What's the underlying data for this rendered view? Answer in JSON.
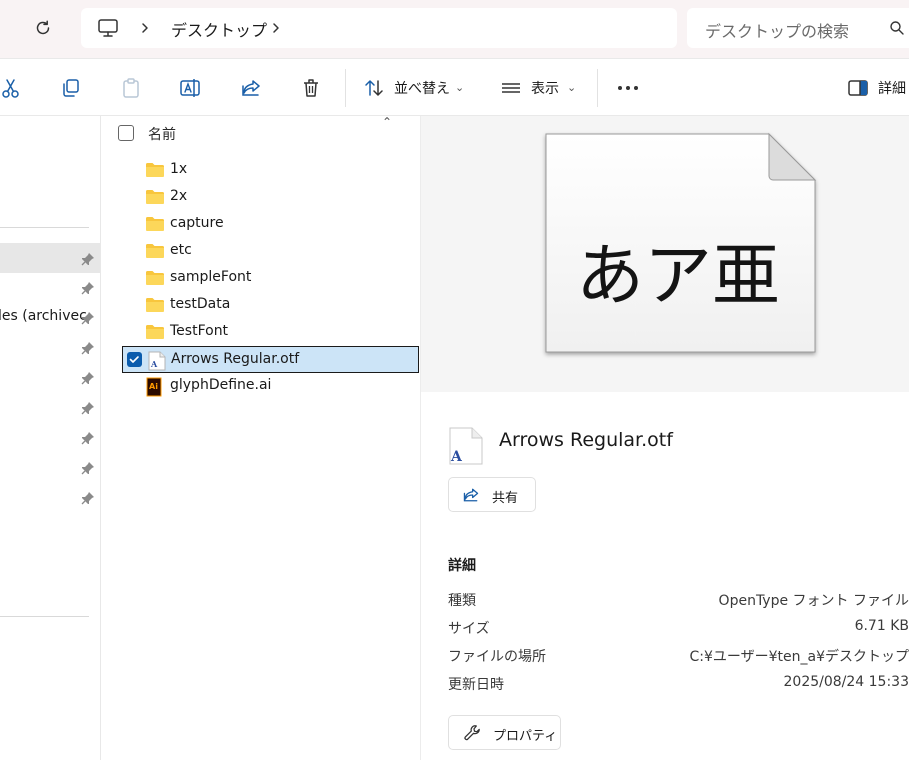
{
  "address": {
    "breadcrumb": "デスクトップ",
    "search_placeholder": "デスクトップの検索"
  },
  "toolbar": {
    "sort_label": "並べ替え",
    "view_label": "表示",
    "details_label": "詳細"
  },
  "nav": {
    "partial_label": "les (archivec"
  },
  "list": {
    "header_name": "名前",
    "items": [
      {
        "name": "1x",
        "type": "folder"
      },
      {
        "name": "2x",
        "type": "folder"
      },
      {
        "name": "capture",
        "type": "folder"
      },
      {
        "name": "etc",
        "type": "folder"
      },
      {
        "name": "sampleFont",
        "type": "folder"
      },
      {
        "name": "testData",
        "type": "folder"
      },
      {
        "name": "TestFont",
        "type": "folder"
      },
      {
        "name": "Arrows Regular.otf",
        "type": "font",
        "selected": true
      },
      {
        "name": "glyphDefine.ai",
        "type": "illustrator"
      }
    ]
  },
  "preview": {
    "thumb_text": "あア亜",
    "title": "Arrows Regular.otf",
    "share_label": "共有",
    "details_heading": "詳細",
    "properties": [
      {
        "key": "種類",
        "value": "OpenType フォント ファイル"
      },
      {
        "key": "サイズ",
        "value": "6.71 KB"
      },
      {
        "key": "ファイルの場所",
        "value": "C:¥ユーザー¥ten_a¥デスクトップ"
      },
      {
        "key": "更新日時",
        "value": "2025/08/24 15:33"
      }
    ],
    "properties_button": "プロパティ"
  },
  "colors": {
    "selection_bg": "#cce4f7",
    "check_blue": "#0b5cad",
    "folder_yellow": "#f8c63d",
    "addr_bg": "#f9f3f4"
  }
}
